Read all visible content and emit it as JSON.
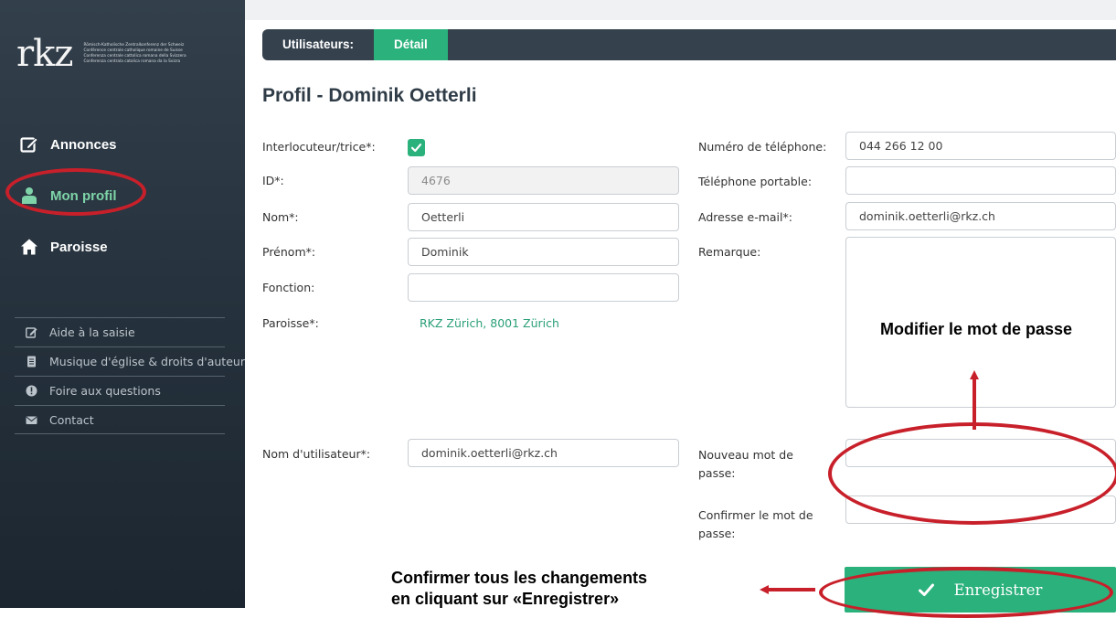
{
  "logo": {
    "mark": "rkz",
    "tagline": [
      "Römisch-Katholische Zentralkonferenz der Schweiz",
      "Conférence centrale catholique romaine de Suisse",
      "Conferenza centrale cattolica romana della Svizzera",
      "Conferenza centrala catolica romana da la Svizra"
    ]
  },
  "sidebar": {
    "main_items": [
      {
        "label": "Annonces",
        "icon": "edit-icon"
      },
      {
        "label": "Mon profil",
        "icon": "user-icon",
        "active": true
      },
      {
        "label": "Paroisse",
        "icon": "home-icon"
      }
    ],
    "sub_items": [
      {
        "label": "Aide à la saisie",
        "icon": "edit-icon"
      },
      {
        "label": "Musique d'église & droits d'auteur",
        "icon": "document-icon"
      },
      {
        "label": "Foire aux questions",
        "icon": "info-icon"
      },
      {
        "label": "Contact",
        "icon": "mail-icon"
      }
    ]
  },
  "breadcrumb": [
    "Utilisateurs:",
    "Détail"
  ],
  "page": {
    "title": "Profil - Dominik Oetterli"
  },
  "form": {
    "left": {
      "interlocutor_label": "Interlocuteur/trice*:",
      "interlocutor_checked": true,
      "id_label": "ID*:",
      "id_value": "4676",
      "nom_label": "Nom*:",
      "nom_value": "Oetterli",
      "prenom_label": "Prénom*:",
      "prenom_value": "Dominik",
      "fonction_label": "Fonction:",
      "fonction_value": "",
      "paroisse_label": "Paroisse*:",
      "paroisse_value": "RKZ Zürich, 8001 Zürich",
      "username_label": "Nom d'utilisateur*:",
      "username_value": "dominik.oetterli@rkz.ch"
    },
    "right": {
      "phone_label": "Numéro de téléphone:",
      "phone_value": "044 266 12 00",
      "mobile_label": "Téléphone portable:",
      "mobile_value": "",
      "email_label": "Adresse e-mail*:",
      "email_value": "dominik.oetterli@rkz.ch",
      "remark_label": "Remarque:",
      "remark_value": "",
      "new_password_label": "Nouveau mot de passe:",
      "confirm_password_label": "Confirmer le mot de passe:"
    },
    "save_label": "Enregistrer"
  },
  "annotations": {
    "password_note": "Modifier le mot de passe",
    "save_note_line1": "Confirmer tous les changements",
    "save_note_line2": "en cliquant sur «Enregistrer»",
    "color": "#c8202a"
  },
  "colors": {
    "sidebar_bg": "#2b3743",
    "accent_green": "#2ab17c",
    "active_nav": "#7ed4a8",
    "annotation_red": "#c8202a"
  }
}
